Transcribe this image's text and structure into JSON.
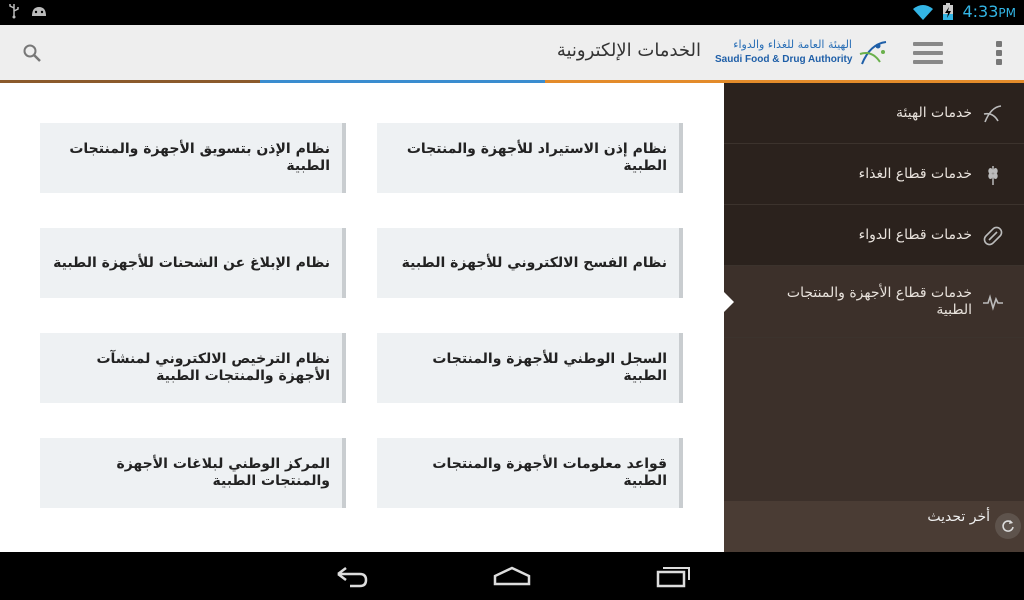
{
  "status_bar": {
    "time": "4:33",
    "time_suffix": "PM",
    "icons": [
      "usb-icon",
      "android-debug-icon",
      "wifi-icon",
      "battery-charging-icon"
    ]
  },
  "action_bar": {
    "title": "الخدمات الإلكترونية",
    "logo_arabic": "الهيئة العامة للغذاء والدواء",
    "logo_english": "Saudi Food & Drug Authority",
    "icons": [
      "overflow-menu-icon",
      "drawer-menu-icon",
      "search-icon"
    ]
  },
  "services": [
    "نظام إذن الاستيراد للأجهزة والمنتجات الطبية",
    "نظام الإذن بتسويق الأجهزة والمنتجات الطبية",
    "نظام الفسح الالكتروني للأجهزة الطبية",
    "نظام الإبلاغ عن الشحنات للأجهزة الطبية",
    "السجل الوطني للأجهزة والمنتجات الطبية",
    "نظام الترخيص الالكتروني لمنشآت الأجهزة والمنتجات الطبية",
    "قواعد معلومات الأجهزة والمنتجات الطبية",
    "المركز الوطني لبلاغات الأجهزة والمنتجات الطبية"
  ],
  "drawer": {
    "items": [
      {
        "label": "خدمات الهيئة",
        "icon": "sfda-logo-icon"
      },
      {
        "label": "خدمات قطاع الغذاء",
        "icon": "wheat-icon"
      },
      {
        "label": "خدمات قطاع الدواء",
        "icon": "pill-icon"
      },
      {
        "label": "خدمات قطاع الأجهزة والمنتجات الطبية",
        "icon": "heartbeat-icon",
        "selected": true
      }
    ],
    "footer_label": "أخر تحديث",
    "footer_icon": "refresh-icon"
  },
  "nav_bar": {
    "icons": [
      "back-icon",
      "home-icon",
      "recent-apps-icon"
    ]
  },
  "colors": {
    "drawer_bg": "#2b221d",
    "drawer_selected": "#3c302a",
    "card_bg": "#eef1f3",
    "status_time": "#33b5e5"
  }
}
